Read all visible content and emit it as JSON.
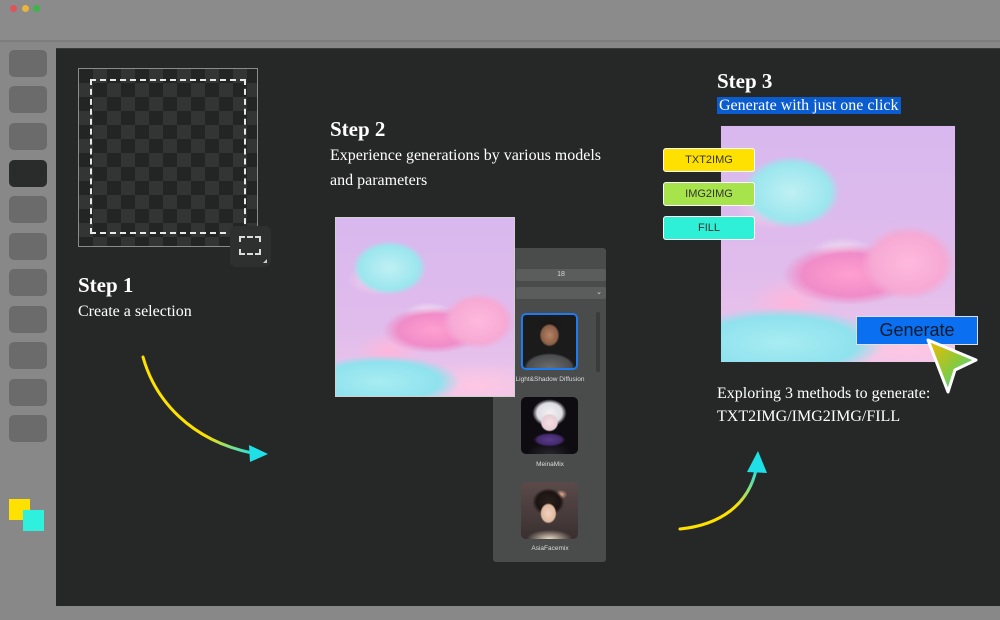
{
  "window": {
    "controls": [
      "close",
      "minimize",
      "maximize"
    ]
  },
  "toolbar": {
    "tools": [
      {
        "name": "tool-1",
        "active": false
      },
      {
        "name": "tool-2",
        "active": false
      },
      {
        "name": "tool-3",
        "active": false
      },
      {
        "name": "tool-4",
        "active": true
      },
      {
        "name": "tool-5",
        "active": false
      },
      {
        "name": "tool-6",
        "active": false
      },
      {
        "name": "tool-7",
        "active": false
      },
      {
        "name": "tool-8",
        "active": false
      },
      {
        "name": "tool-9",
        "active": false
      },
      {
        "name": "tool-10",
        "active": false
      },
      {
        "name": "tool-11",
        "active": false
      }
    ],
    "foreground_color": "#ffe100",
    "background_color": "#2ef0dc"
  },
  "step1": {
    "title": "Step 1",
    "description": "Create a selection",
    "tool_icon": "marquee-select-icon"
  },
  "step2": {
    "title": "Step 2",
    "description_line1": "Experience generations by various models",
    "description_line2": "and parameters",
    "model_panel": {
      "field_value": "18",
      "models": [
        {
          "label": "Light&Shadow Diffusion",
          "selected": true
        },
        {
          "label": "MeinaMix",
          "selected": false
        },
        {
          "label": "AsiaFacemix",
          "selected": false
        }
      ]
    }
  },
  "step3": {
    "title": "Step 3",
    "highlighted_description": "Generate with just one click",
    "methods": [
      {
        "label": "TXT2IMG",
        "color": "#ffe100"
      },
      {
        "label": "IMG2IMG",
        "color": "#a7e34a"
      },
      {
        "label": "FILL",
        "color": "#2ef0d6"
      }
    ],
    "generate_label": "Generate",
    "note_line1": "Exploring 3 methods to generate:",
    "note_line2": "TXT2IMG/IMG2IMG/FILL"
  },
  "colors": {
    "accent_blue": "#0a6ff0",
    "highlight_blue": "#0a5ccf",
    "arrow_start": "#ffe100",
    "arrow_end": "#1fe0e6"
  }
}
